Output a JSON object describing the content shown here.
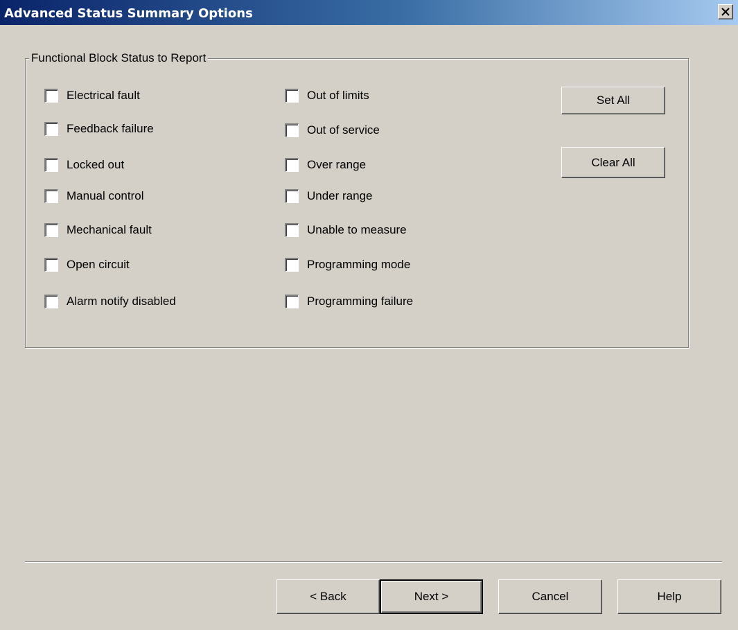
{
  "window": {
    "title": "Advanced Status Summary Options"
  },
  "group": {
    "legend": "Functional Block Status to Report",
    "left_options": [
      {
        "label": "Electrical fault",
        "checked": false
      },
      {
        "label": "Feedback failure",
        "checked": false
      },
      {
        "label": "Locked out",
        "checked": false
      },
      {
        "label": "Manual control",
        "checked": false
      },
      {
        "label": "Mechanical fault",
        "checked": false
      },
      {
        "label": "Open circuit",
        "checked": false
      },
      {
        "label": "Alarm notify disabled",
        "checked": false
      }
    ],
    "right_options": [
      {
        "label": "Out of limits",
        "checked": false
      },
      {
        "label": "Out of service",
        "checked": false
      },
      {
        "label": "Over range",
        "checked": false
      },
      {
        "label": "Under range",
        "checked": false
      },
      {
        "label": "Unable to measure",
        "checked": false
      },
      {
        "label": "Programming mode",
        "checked": false
      },
      {
        "label": "Programming failure",
        "checked": false
      }
    ],
    "set_all_label": "Set All",
    "clear_all_label": "Clear All"
  },
  "footer": {
    "back_label": "< Back",
    "next_label": "Next >",
    "cancel_label": "Cancel",
    "help_label": "Help"
  }
}
